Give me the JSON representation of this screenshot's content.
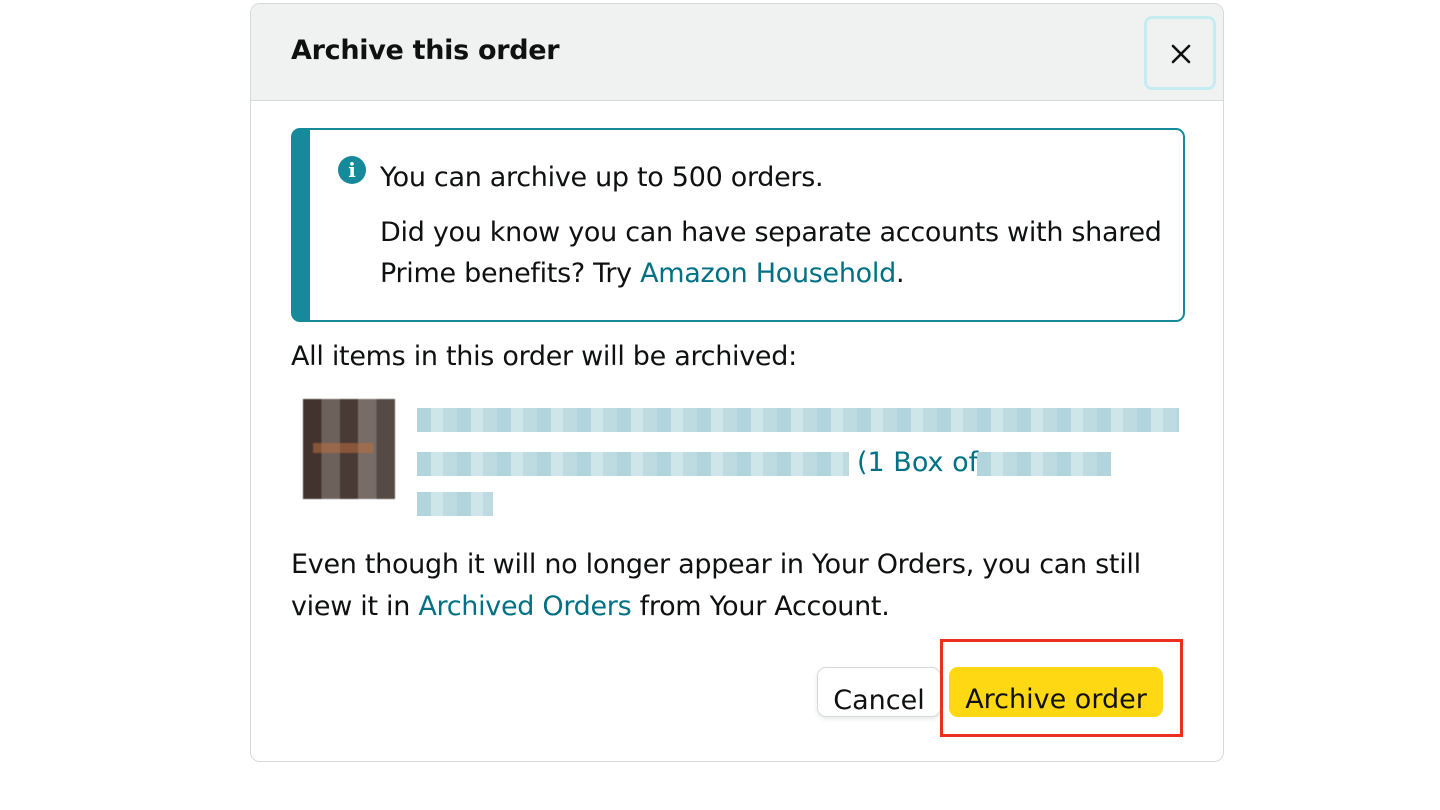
{
  "dialog": {
    "title": "Archive this order",
    "close_icon": "close-x-icon"
  },
  "info_box": {
    "icon": "info-icon",
    "icon_glyph": "i",
    "line1": "You can archive up to 500 orders.",
    "line2_prefix": "Did you know you can have separate accounts with shared Prime benefits? Try ",
    "line2_link": "Amazon Household",
    "line2_suffix": "."
  },
  "items": {
    "heading": "All items in this order will be archived:",
    "product": {
      "visible_title_fragment": "(1 Box of"
    }
  },
  "note": {
    "prefix": "Even though it will no longer appear in Your Orders, you can still view it in ",
    "link": "Archived Orders",
    "suffix": " from Your Account."
  },
  "buttons": {
    "cancel_label": "Cancel",
    "archive_label": "Archive order"
  },
  "colors": {
    "accent_teal": "#168a9b",
    "link": "#007185",
    "primary_button": "#ffd814",
    "highlight": "#e8301c",
    "header_bg": "#f0f2f2"
  }
}
